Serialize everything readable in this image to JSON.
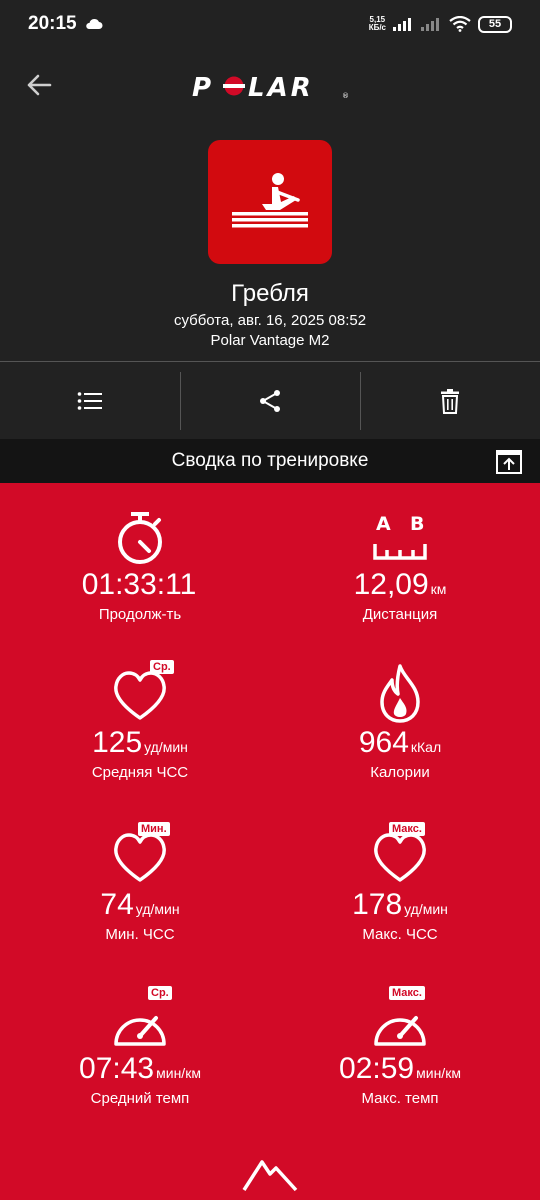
{
  "status_bar": {
    "time": "20:15",
    "speed_value": "5,15",
    "speed_unit": "КБ/с",
    "battery": "55",
    "icons": [
      "cloud-icon",
      "signal-icon",
      "signal-icon",
      "wifi-icon",
      "battery-icon"
    ]
  },
  "header": {
    "logo_text": "POLAR",
    "sport_name": "Гребля",
    "date": "суббота, авг. 16, 2025 08:52",
    "device": "Polar Vantage M2",
    "sport_tile_color": "#d20a0f"
  },
  "actions": [
    "list-icon",
    "share-icon",
    "trash-icon"
  ],
  "summary": {
    "title": "Сводка по тренировке",
    "background_color": "#d20a27",
    "metrics": [
      {
        "value": "01:33:11",
        "unit": "",
        "label": "Продолж-ть",
        "badge": "",
        "icon": "stopwatch-icon"
      },
      {
        "value": "12,09",
        "unit": "км",
        "label": "Дистанция",
        "badge": "",
        "icon": "distance-icon",
        "distance_a": "A",
        "distance_b": "B"
      },
      {
        "value": "125",
        "unit": "уд/мин",
        "label": "Средняя ЧСС",
        "badge": "Ср.",
        "icon": "heart-icon"
      },
      {
        "value": "964",
        "unit": "кКал",
        "label": "Калории",
        "badge": "",
        "icon": "flame-icon"
      },
      {
        "value": "74",
        "unit": "уд/мин",
        "label": "Мин. ЧСС",
        "badge": "Мин.",
        "icon": "heart-icon"
      },
      {
        "value": "178",
        "unit": "уд/мин",
        "label": "Макс. ЧСС",
        "badge": "Макс.",
        "icon": "heart-icon"
      },
      {
        "value": "07:43",
        "unit": "мин/км",
        "label": "Средний темп",
        "badge": "Ср.",
        "icon": "speedometer-icon"
      },
      {
        "value": "02:59",
        "unit": "мин/км",
        "label": "Макс. темп",
        "badge": "Макс.",
        "icon": "speedometer-icon"
      }
    ]
  }
}
